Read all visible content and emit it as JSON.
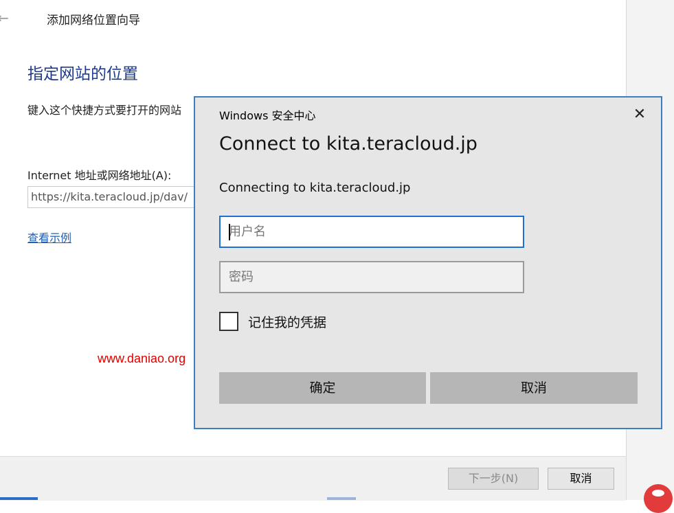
{
  "wizard": {
    "title": "添加网络位置向导",
    "back_icon": "arrow-left-icon",
    "heading": "指定网站的位置",
    "description": "键入这个快捷方式要打开的网站",
    "address_label": "Internet 地址或网络地址(A):",
    "address_value": "https://kita.teracloud.jp/dav/",
    "example_link": "查看示例",
    "watermark": "www.daniao.org",
    "footer": {
      "next_label": "下一步(N)",
      "cancel_label": "取消"
    }
  },
  "dialog": {
    "caption": "Windows 安全中心",
    "close_icon": "close-icon",
    "heading": "Connect to kita.teracloud.jp",
    "message": "Connecting to kita.teracloud.jp",
    "username_placeholder": "用户名",
    "password_placeholder": "密码",
    "remember_label": "记住我的凭据",
    "remember_checked": false,
    "ok_label": "确定",
    "cancel_label": "取消"
  },
  "colors": {
    "heading_blue": "#1e3a8a",
    "link_blue": "#1e5fb8",
    "dialog_border": "#3c7fc1",
    "focus_border": "#1d6fd0",
    "watermark_red": "#e00000"
  }
}
